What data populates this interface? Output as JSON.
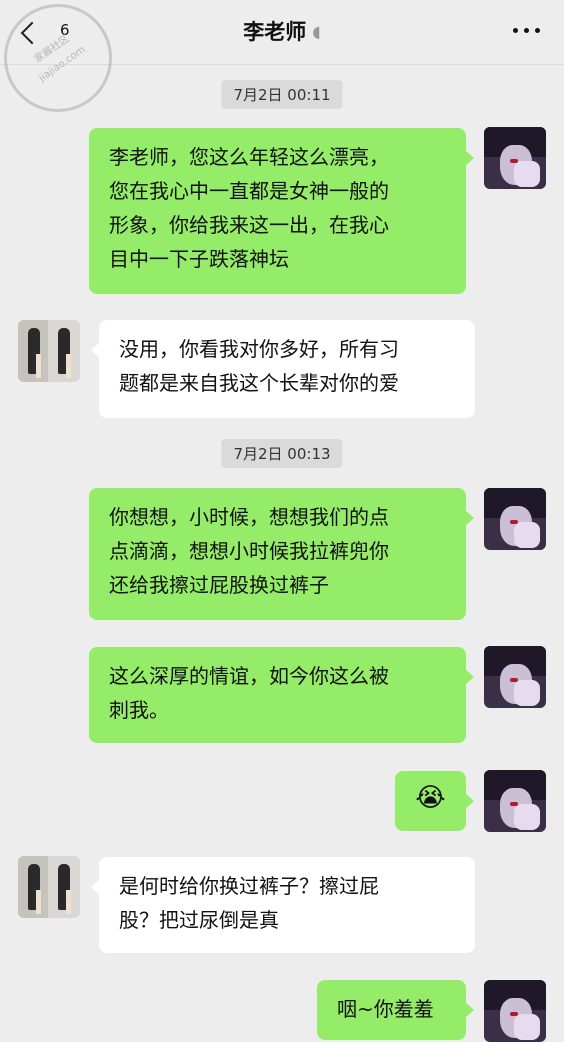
{
  "header": {
    "unread_count": "6",
    "title": "李老师"
  },
  "watermark": {
    "line1": "家酱社区",
    "line2": "jiajiao.com"
  },
  "timestamps": [
    "7月2日 00:11",
    "7月2日 00:13"
  ],
  "messages": [
    {
      "from": "me",
      "lines": [
        "李老师，您这么年轻这么漂亮，",
        "您在我心中一直都是女神一般的",
        "形象，你给我来这一出，在我心",
        "目中一下子跌落神坛"
      ]
    },
    {
      "from": "them",
      "lines": [
        "没用，你看我对你多好，所有习",
        "题都是来自我这个长辈对你的爱"
      ]
    },
    {
      "from": "me",
      "lines": [
        "你想想，小时候，想想我们的点",
        "点滴滴，想想小时候我拉裤兜你",
        "还给我擦过屁股换过裤子"
      ]
    },
    {
      "from": "me",
      "lines": [
        "这么深厚的情谊，如今你这么被",
        "刺我。"
      ]
    },
    {
      "from": "me",
      "emoji": "😭"
    },
    {
      "from": "them",
      "lines": [
        "是何时给你换过裤子？擦过屁",
        "股？把过尿倒是真"
      ]
    },
    {
      "from": "me",
      "lines": [
        "咽~你羞羞"
      ]
    }
  ]
}
